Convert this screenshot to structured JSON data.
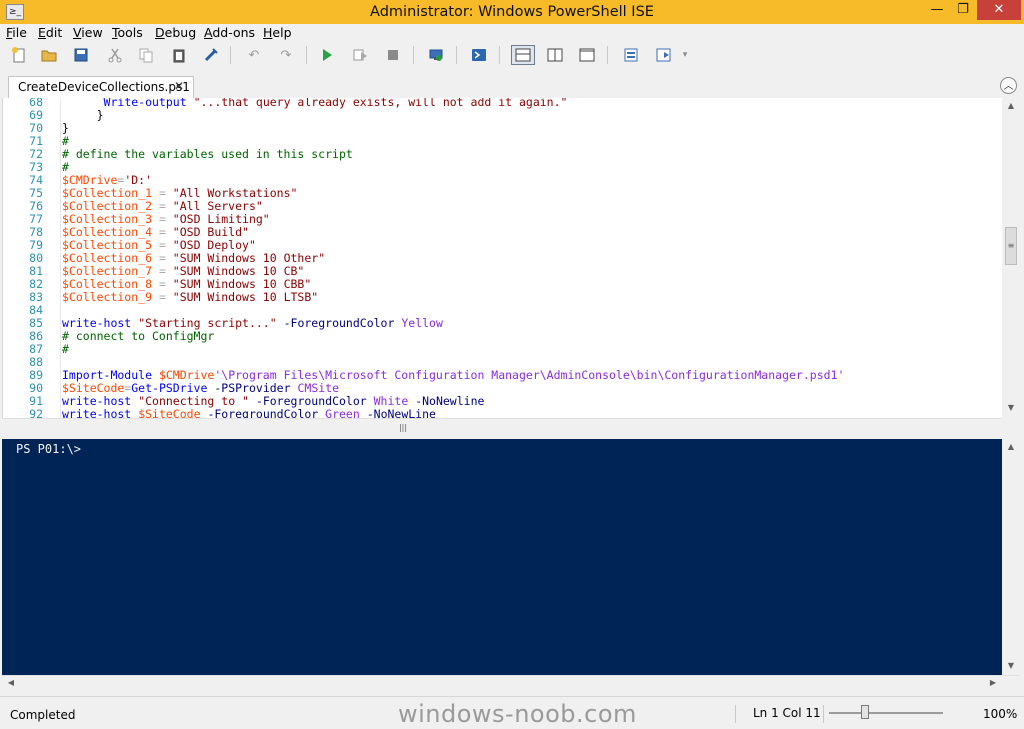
{
  "window": {
    "title": "Administrator: Windows PowerShell ISE",
    "app_icon": "powershell-ise-icon",
    "minimize": "—",
    "maximize": "❐",
    "close": "✕"
  },
  "menu": [
    "File",
    "Edit",
    "View",
    "Tools",
    "Debug",
    "Add-ons",
    "Help"
  ],
  "toolbar": {
    "buttons": [
      "new-file-icon",
      "open-icon",
      "save-icon",
      "cut-icon",
      "copy-icon",
      "paste-icon",
      "clear-console-icon",
      "undo-icon",
      "redo-icon",
      "run-script-icon",
      "run-selection-icon",
      "stop-icon",
      "new-remote-tab-icon",
      "start-powershell-icon",
      "show-script-top-icon",
      "show-script-right-icon",
      "show-script-max-icon",
      "show-command-window-icon",
      "show-command-addon-icon"
    ]
  },
  "tabs": [
    {
      "label": "CreateDeviceCollections.ps1",
      "close": "✕",
      "active": true
    }
  ],
  "editor": {
    "lines": [
      {
        "num": "68",
        "tokens": [
          {
            "t": "      ",
            "c": ""
          },
          {
            "t": "Write-output",
            "c": "c-cmd"
          },
          {
            "t": " ",
            "c": ""
          },
          {
            "t": "\"...that query already exists, will not add it again.\"",
            "c": "c-str"
          }
        ]
      },
      {
        "num": "69",
        "tokens": [
          {
            "t": "     }",
            "c": ""
          }
        ]
      },
      {
        "num": "70",
        "tokens": [
          {
            "t": "}",
            "c": ""
          }
        ]
      },
      {
        "num": "71",
        "tokens": [
          {
            "t": "#",
            "c": "c-com"
          }
        ]
      },
      {
        "num": "72",
        "tokens": [
          {
            "t": "# define the variables used in this script",
            "c": "c-com"
          }
        ]
      },
      {
        "num": "73",
        "tokens": [
          {
            "t": "#",
            "c": "c-com"
          }
        ]
      },
      {
        "num": "74",
        "tokens": [
          {
            "t": "$CMDrive",
            "c": "c-var"
          },
          {
            "t": "=",
            "c": "c-op"
          },
          {
            "t": "'D:'",
            "c": "c-str"
          }
        ]
      },
      {
        "num": "75",
        "tokens": [
          {
            "t": "$Collection_1",
            "c": "c-var"
          },
          {
            "t": " = ",
            "c": "c-op"
          },
          {
            "t": "\"All Workstations\"",
            "c": "c-str"
          }
        ]
      },
      {
        "num": "76",
        "tokens": [
          {
            "t": "$Collection_2",
            "c": "c-var"
          },
          {
            "t": " = ",
            "c": "c-op"
          },
          {
            "t": "\"All Servers\"",
            "c": "c-str"
          }
        ]
      },
      {
        "num": "77",
        "tokens": [
          {
            "t": "$Collection_3",
            "c": "c-var"
          },
          {
            "t": " = ",
            "c": "c-op"
          },
          {
            "t": "\"OSD Limiting\"",
            "c": "c-str"
          }
        ]
      },
      {
        "num": "78",
        "tokens": [
          {
            "t": "$Collection_4",
            "c": "c-var"
          },
          {
            "t": " = ",
            "c": "c-op"
          },
          {
            "t": "\"OSD Build\"",
            "c": "c-str"
          }
        ]
      },
      {
        "num": "79",
        "tokens": [
          {
            "t": "$Collection_5",
            "c": "c-var"
          },
          {
            "t": " = ",
            "c": "c-op"
          },
          {
            "t": "\"OSD Deploy\"",
            "c": "c-str"
          }
        ]
      },
      {
        "num": "80",
        "tokens": [
          {
            "t": "$Collection_6",
            "c": "c-var"
          },
          {
            "t": " = ",
            "c": "c-op"
          },
          {
            "t": "\"SUM Windows 10 Other\"",
            "c": "c-str"
          }
        ]
      },
      {
        "num": "81",
        "tokens": [
          {
            "t": "$Collection_7",
            "c": "c-var"
          },
          {
            "t": " = ",
            "c": "c-op"
          },
          {
            "t": "\"SUM Windows 10 CB\"",
            "c": "c-str"
          }
        ]
      },
      {
        "num": "82",
        "tokens": [
          {
            "t": "$Collection_8",
            "c": "c-var"
          },
          {
            "t": " = ",
            "c": "c-op"
          },
          {
            "t": "\"SUM Windows 10 CBB\"",
            "c": "c-str"
          }
        ]
      },
      {
        "num": "83",
        "tokens": [
          {
            "t": "$Collection_9",
            "c": "c-var"
          },
          {
            "t": " = ",
            "c": "c-op"
          },
          {
            "t": "\"SUM Windows 10 LTSB\"",
            "c": "c-str"
          }
        ]
      },
      {
        "num": "84",
        "tokens": []
      },
      {
        "num": "85",
        "tokens": [
          {
            "t": "write-host",
            "c": "c-cmd"
          },
          {
            "t": " ",
            "c": ""
          },
          {
            "t": "\"Starting script...\"",
            "c": "c-str"
          },
          {
            "t": " ",
            "c": ""
          },
          {
            "t": "-ForegroundColor",
            "c": "c-par"
          },
          {
            "t": " ",
            "c": ""
          },
          {
            "t": "Yellow",
            "c": "c-arg"
          }
        ]
      },
      {
        "num": "86",
        "tokens": [
          {
            "t": "# connect to ConfigMgr",
            "c": "c-com"
          }
        ]
      },
      {
        "num": "87",
        "tokens": [
          {
            "t": "#",
            "c": "c-com"
          }
        ]
      },
      {
        "num": "88",
        "tokens": []
      },
      {
        "num": "89",
        "tokens": [
          {
            "t": "Import-Module",
            "c": "c-cmd"
          },
          {
            "t": " ",
            "c": ""
          },
          {
            "t": "$CMDrive",
            "c": "c-var"
          },
          {
            "t": "'\\Program Files\\Microsoft Configuration Manager\\AdminConsole\\bin\\ConfigurationManager.psd1'",
            "c": "c-arg"
          }
        ]
      },
      {
        "num": "90",
        "tokens": [
          {
            "t": "$SiteCode",
            "c": "c-var"
          },
          {
            "t": "=",
            "c": "c-op"
          },
          {
            "t": "Get-PSDrive",
            "c": "c-cmd"
          },
          {
            "t": " ",
            "c": ""
          },
          {
            "t": "-PSProvider",
            "c": "c-par"
          },
          {
            "t": " ",
            "c": ""
          },
          {
            "t": "CMSite",
            "c": "c-arg"
          }
        ]
      },
      {
        "num": "91",
        "tokens": [
          {
            "t": "write-host",
            "c": "c-cmd"
          },
          {
            "t": " ",
            "c": ""
          },
          {
            "t": "\"Connecting to \"",
            "c": "c-str"
          },
          {
            "t": " ",
            "c": ""
          },
          {
            "t": "-ForegroundColor",
            "c": "c-par"
          },
          {
            "t": " ",
            "c": ""
          },
          {
            "t": "White",
            "c": "c-arg"
          },
          {
            "t": " ",
            "c": ""
          },
          {
            "t": "-NoNewline",
            "c": "c-par"
          }
        ]
      },
      {
        "num": "92",
        "tokens": [
          {
            "t": "write-host",
            "c": "c-cmd"
          },
          {
            "t": " ",
            "c": ""
          },
          {
            "t": "$SiteCode",
            "c": "c-var"
          },
          {
            "t": " ",
            "c": ""
          },
          {
            "t": "-ForegroundColor",
            "c": "c-par"
          },
          {
            "t": " ",
            "c": ""
          },
          {
            "t": "Green",
            "c": "c-arg"
          },
          {
            "t": " ",
            "c": ""
          },
          {
            "t": "-NoNewLine",
            "c": "c-par"
          }
        ]
      }
    ]
  },
  "console": {
    "prompt": "PS P01:\\>"
  },
  "status": {
    "text": "Completed",
    "watermark": "windows-noob.com",
    "caret": "Ln 1  Col 11",
    "zoom": "100%"
  },
  "colors": {
    "title_bar": "#f7ba29",
    "console_bg": "#012456",
    "line_numbers": "#2b91af"
  }
}
